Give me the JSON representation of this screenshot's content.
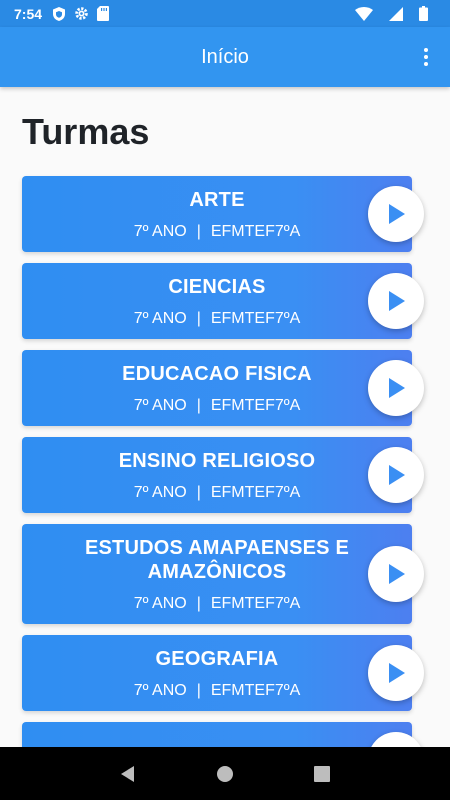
{
  "status": {
    "time": "7:54",
    "icons": [
      "shield-icon",
      "gear-icon",
      "sd-card-icon"
    ],
    "right_icons": [
      "wifi-icon",
      "signal-icon",
      "battery-icon"
    ]
  },
  "appbar": {
    "title": "Início",
    "menu_icon": "more-vert-icon"
  },
  "page": {
    "heading": "Turmas"
  },
  "classes": [
    {
      "name": "ARTE",
      "grade": "7º ANO",
      "separator": "|",
      "code": "EFMTEF7ºA"
    },
    {
      "name": "CIENCIAS",
      "grade": "7º ANO",
      "separator": "|",
      "code": "EFMTEF7ºA"
    },
    {
      "name": "EDUCACAO FISICA",
      "grade": "7º ANO",
      "separator": "|",
      "code": "EFMTEF7ºA"
    },
    {
      "name": "ENSINO RELIGIOSO",
      "grade": "7º ANO",
      "separator": "|",
      "code": "EFMTEF7ºA"
    },
    {
      "name": "ESTUDOS AMAPAENSES E AMAZÔNICOS",
      "grade": "7º ANO",
      "separator": "|",
      "code": "EFMTEF7ºA"
    },
    {
      "name": "GEOGRAFIA",
      "grade": "7º ANO",
      "separator": "|",
      "code": "EFMTEF7ºA"
    },
    {
      "name": "",
      "grade": "",
      "separator": "",
      "code": ""
    }
  ],
  "colors": {
    "status_bar": "#2a8ae4",
    "app_bar": "#3295f0",
    "card": "#3a8ff3",
    "play_arrow": "#3a8ff3",
    "nav_bar": "#000000"
  },
  "navbar": {
    "buttons": [
      "back-icon",
      "home-icon",
      "recents-icon"
    ]
  }
}
